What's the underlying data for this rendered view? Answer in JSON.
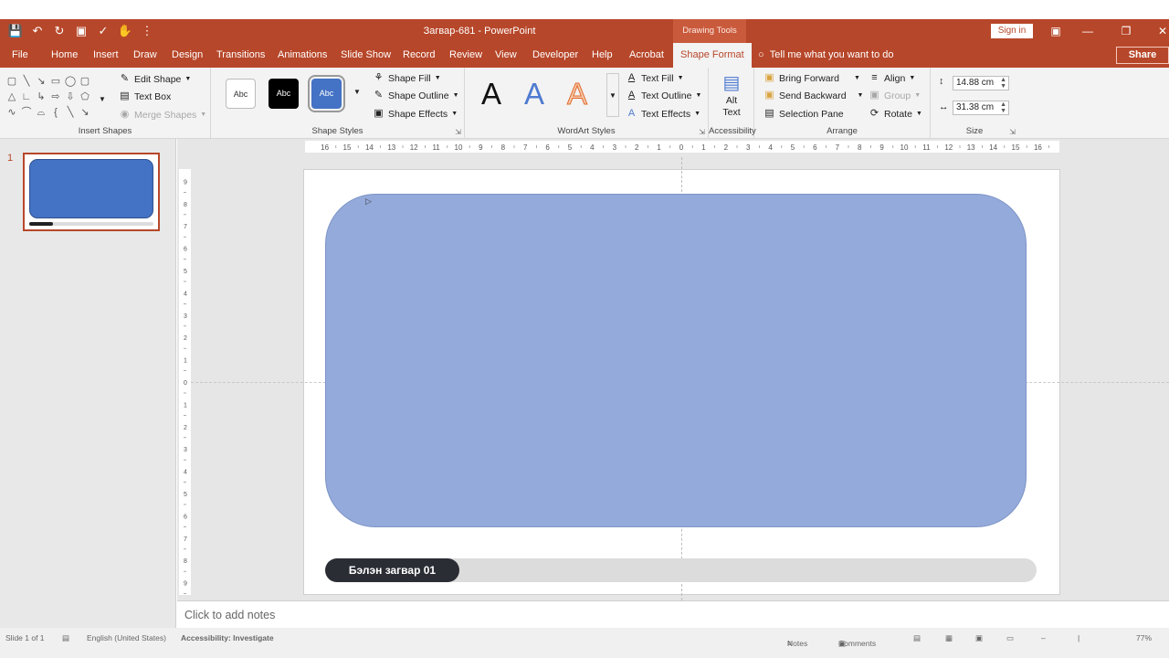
{
  "window": {
    "title": "Загвар-681  -  PowerPoint",
    "context_tab_group": "Drawing Tools",
    "sign_in": "Sign in",
    "share": "Share"
  },
  "tabs": [
    {
      "label": "File"
    },
    {
      "label": "Home"
    },
    {
      "label": "Insert"
    },
    {
      "label": "Draw"
    },
    {
      "label": "Design"
    },
    {
      "label": "Transitions"
    },
    {
      "label": "Animations"
    },
    {
      "label": "Slide Show"
    },
    {
      "label": "Record"
    },
    {
      "label": "Review"
    },
    {
      "label": "View"
    },
    {
      "label": "Developer"
    },
    {
      "label": "Help"
    },
    {
      "label": "Acrobat"
    },
    {
      "label": "Shape Format"
    }
  ],
  "tell_me": "Tell me what you want to do",
  "ribbon": {
    "insert_shapes": {
      "label": "Insert Shapes",
      "edit_shape": "Edit Shape",
      "text_box": "Text Box",
      "merge_shapes": "Merge Shapes"
    },
    "shape_styles": {
      "label": "Shape Styles",
      "style_sample": "Abc",
      "shape_fill": "Shape Fill",
      "shape_outline": "Shape Outline",
      "shape_effects": "Shape Effects"
    },
    "wordart_styles": {
      "label": "WordArt Styles",
      "sample": "A",
      "text_fill": "Text Fill",
      "text_outline": "Text Outline",
      "text_effects": "Text Effects"
    },
    "accessibility": {
      "label": "Accessibility",
      "alt_text_line1": "Alt",
      "alt_text_line2": "Text"
    },
    "arrange": {
      "label": "Arrange",
      "bring_forward": "Bring Forward",
      "send_backward": "Send Backward",
      "selection_pane": "Selection Pane",
      "align": "Align",
      "group": "Group",
      "rotate": "Rotate"
    },
    "size": {
      "label": "Size",
      "height": "14.88 cm",
      "width": "31.38 cm"
    }
  },
  "slides_pane": {
    "slide_number": "1"
  },
  "slide": {
    "progress_label": "Бэлэн загвар 01"
  },
  "notes_placeholder": "Click to add notes",
  "status_bar": {
    "slide_info": "Slide 1 of 1",
    "language": "English (United States)",
    "accessibility": "Accessibility: Investigate",
    "notes": "Notes",
    "comments": "Comments",
    "zoom": "77%"
  },
  "colors": {
    "accent": "#b7472a",
    "shape_fill": "#94aadb",
    "thumb_fill": "#4472c4",
    "pill": "#2a2d34"
  }
}
